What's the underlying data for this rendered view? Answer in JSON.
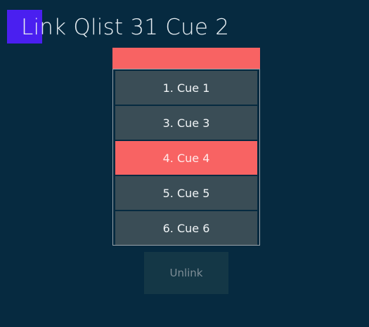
{
  "title": "Link Qlist 31 Cue 2",
  "colors": {
    "background": "#062a40",
    "accent": "#4a1ff0",
    "highlight": "#f86363",
    "item": "#3a4d56"
  },
  "cue_list": {
    "items": [
      {
        "label": "1. Cue 1",
        "selected": false
      },
      {
        "label": "3. Cue 3",
        "selected": false
      },
      {
        "label": "4. Cue 4",
        "selected": true
      },
      {
        "label": "5. Cue 5",
        "selected": false
      },
      {
        "label": "6. Cue 6",
        "selected": false
      }
    ]
  },
  "unlink_button": {
    "label": "Unlink",
    "disabled": true
  }
}
